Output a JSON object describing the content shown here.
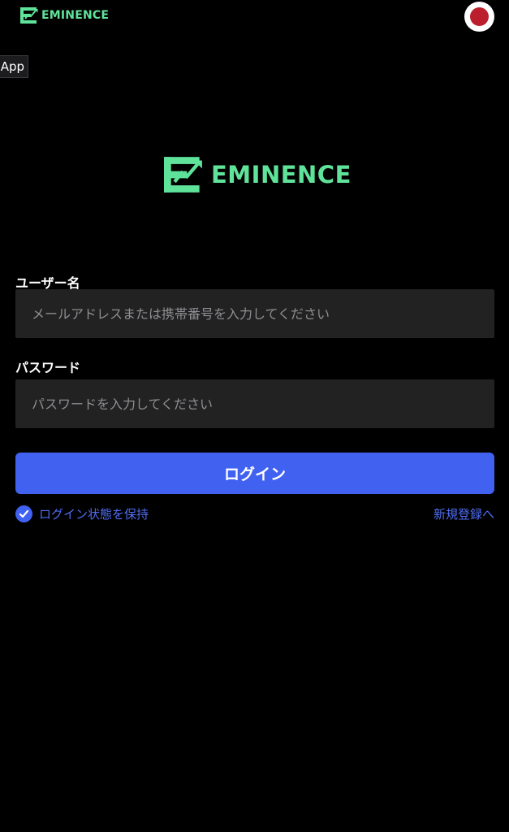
{
  "header": {
    "logo_text": "EMINENCE",
    "logo_icon": "eminence-e-chart-icon",
    "language_flag": "japan-flag-icon"
  },
  "app_badge": {
    "label": "App"
  },
  "brand": {
    "logo_text": "EMINENCE",
    "logo_icon": "eminence-e-chart-icon"
  },
  "form": {
    "username": {
      "label": "ユーザー名",
      "placeholder": "メールアドレスまたは携帯番号を入力してください",
      "value": ""
    },
    "password": {
      "label": "パスワード",
      "placeholder": "パスワードを入力してください",
      "value": ""
    },
    "login_button": "ログイン",
    "remember_me": {
      "label": "ログイン状態を保持",
      "checked": true
    },
    "register_link": "新規登録へ"
  },
  "colors": {
    "background": "#000000",
    "brand_green": "#5fe39a",
    "accent_blue": "#4161f0",
    "link_blue": "#4f6df2",
    "flag_red": "#bc1e2d",
    "input_bg": "#222222"
  }
}
